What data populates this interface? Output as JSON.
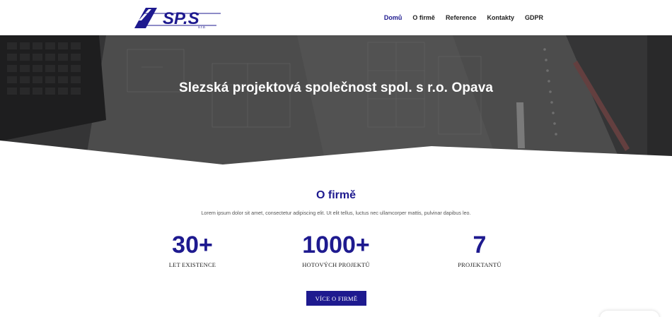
{
  "brand": {
    "logo_text": "SP.S",
    "logo_subtext": "s.r.o.",
    "accent_color": "#1e1a8f"
  },
  "nav": {
    "items": [
      {
        "label": "Domů",
        "active": true
      },
      {
        "label": "O firmě",
        "active": false
      },
      {
        "label": "Reference",
        "active": false
      },
      {
        "label": "Kontakty",
        "active": false
      },
      {
        "label": "GDPR",
        "active": false
      }
    ]
  },
  "hero": {
    "title": "Slezská projektová společnost spol. s r.o. Opava"
  },
  "about": {
    "title": "O firmě",
    "text": "Lorem ipsum dolor sit amet, consectetur adipiscing elit. Ut elit tellus, luctus nec ullamcorper mattis, pulvinar dapibus leo.",
    "stats": [
      {
        "number": "30+",
        "label": "LET EXISTENCE"
      },
      {
        "number": "1000+",
        "label": "HOTOVÝCH PROJEKTŮ"
      },
      {
        "number": "7",
        "label": "PROJEKTANTŮ"
      }
    ],
    "button_label": "VÍCE O FIRMĚ"
  }
}
